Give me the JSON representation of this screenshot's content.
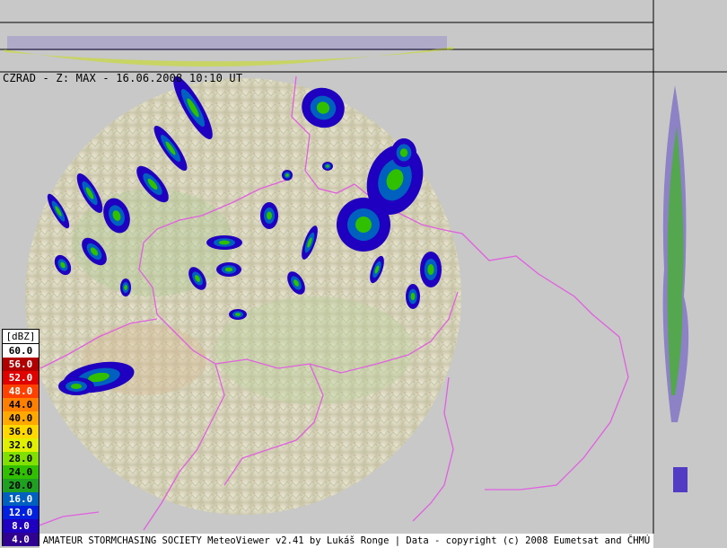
{
  "title": "CZRAD - Z: MAX - 16.06.2008 10:10 UT",
  "legend": {
    "unit": "[dBZ]",
    "entries": [
      {
        "label": "60.0",
        "color": "#ffffff",
        "text": "#000000"
      },
      {
        "label": "56.0",
        "color": "#b00000",
        "text": "#ffffff"
      },
      {
        "label": "52.0",
        "color": "#e00000",
        "text": "#ffffff"
      },
      {
        "label": "48.0",
        "color": "#ff4000",
        "text": "#ffffff"
      },
      {
        "label": "44.0",
        "color": "#ff8000",
        "text": "#000000"
      },
      {
        "label": "40.0",
        "color": "#ffa800",
        "text": "#000000"
      },
      {
        "label": "36.0",
        "color": "#ffd800",
        "text": "#000000"
      },
      {
        "label": "32.0",
        "color": "#e0f000",
        "text": "#000000"
      },
      {
        "label": "28.0",
        "color": "#80e000",
        "text": "#000000"
      },
      {
        "label": "24.0",
        "color": "#30c000",
        "text": "#000000"
      },
      {
        "label": "20.0",
        "color": "#20a020",
        "text": "#000000"
      },
      {
        "label": "16.0",
        "color": "#0060c0",
        "text": "#ffffff"
      },
      {
        "label": "12.0",
        "color": "#0020e0",
        "text": "#ffffff"
      },
      {
        "label": "8.0",
        "color": "#2000c0",
        "text": "#ffffff"
      },
      {
        "label": "4.0",
        "color": "#300090",
        "text": "#ffffff"
      }
    ]
  },
  "footer": "AMATEUR STORMCHASING SOCIETY MeteoViewer v2.41 by Lukáš Ronge | Data - copyright (c) 2008 Eumetsat and ČHMÚ",
  "colors": {
    "background": "#c8c8c8",
    "border_line": "#e060e0",
    "radar_dome": "#dcd8c4"
  }
}
